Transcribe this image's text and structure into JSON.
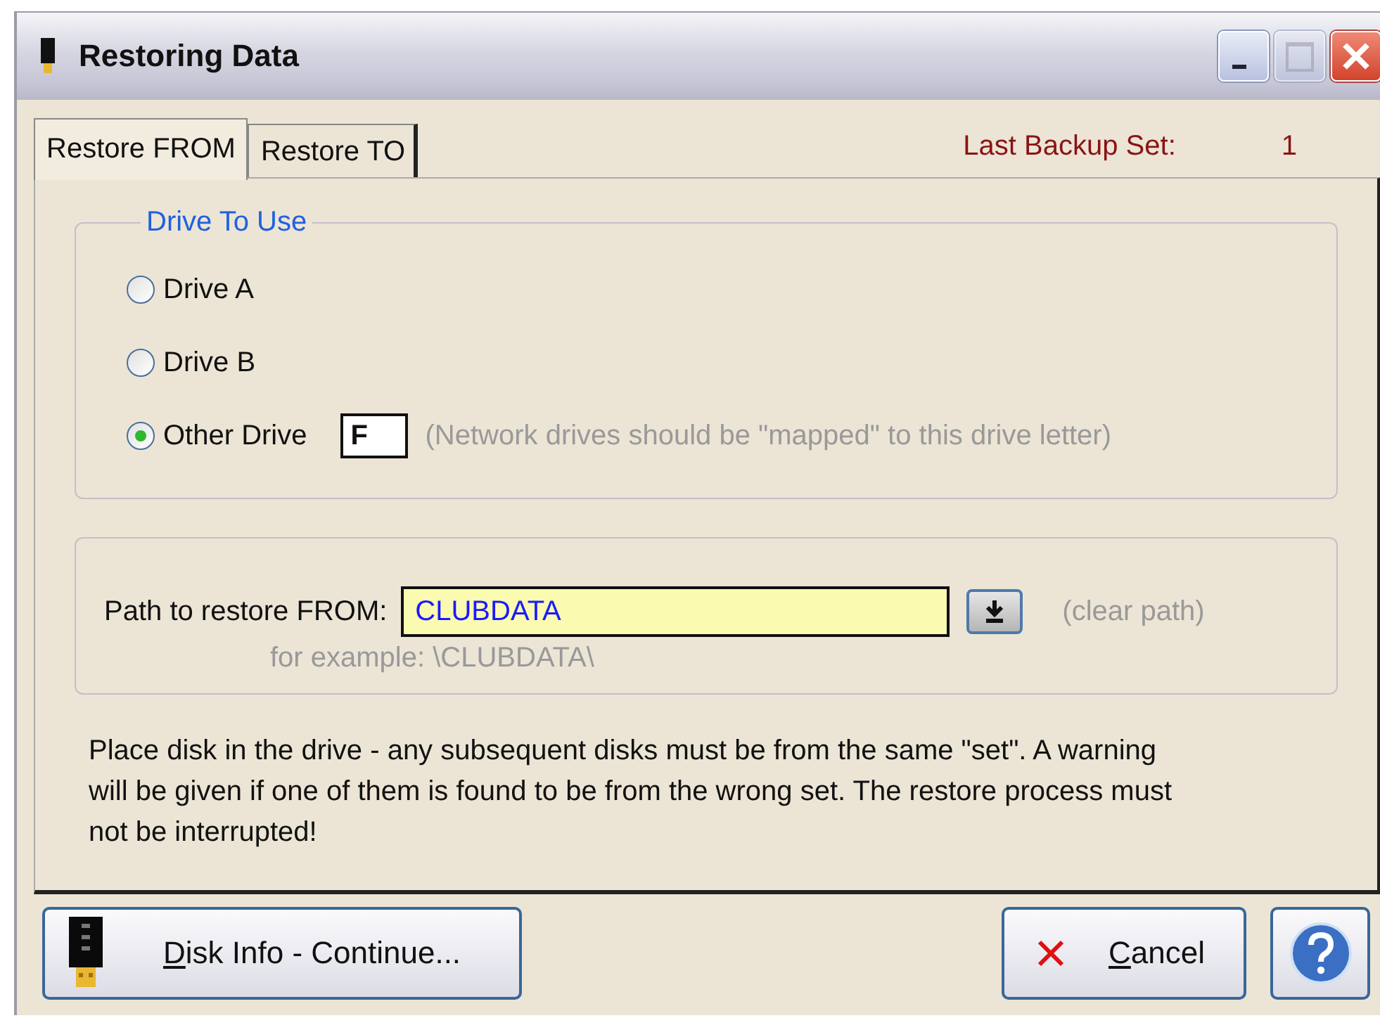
{
  "window": {
    "title": "Restoring Data",
    "controls": [
      {
        "kind": "minimize",
        "disabled": false
      },
      {
        "kind": "maximize",
        "disabled": true
      },
      {
        "kind": "close",
        "disabled": false
      }
    ]
  },
  "tabs": [
    {
      "label": "Restore FROM",
      "selected": true
    },
    {
      "label": "Restore TO",
      "selected": false
    }
  ],
  "last_backup": {
    "label": "Last Backup Set:",
    "value": "1"
  },
  "drive_group": {
    "legend": "Drive To Use",
    "options": [
      {
        "label": "Drive A",
        "selected": false
      },
      {
        "label": "Drive B",
        "selected": false
      },
      {
        "label": "Other Drive",
        "selected": true
      }
    ],
    "drive_letter": "F",
    "note": "(Network drives should be \"mapped\" to this drive letter)"
  },
  "path_group": {
    "label": "Path to restore FROM:",
    "value": "CLUBDATA",
    "clear_link": "(clear path)",
    "example": "for example: \\CLUBDATA\\"
  },
  "message": "Place disk in the drive - any subsequent disks must be from the same \"set\". A warning will be given if one of them is found to be from the wrong set. The restore process must not be interrupted!",
  "buttons": [
    {
      "kind": "continue",
      "accel": "D",
      "rest": "isk Info - Continue..."
    },
    {
      "kind": "cancel",
      "accel": "C",
      "rest": "ancel"
    },
    {
      "kind": "help"
    }
  ]
}
